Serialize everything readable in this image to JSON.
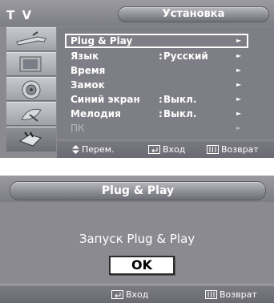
{
  "menu": {
    "tv_label": "T V",
    "title": "Установка",
    "items": [
      {
        "label": "Plug & Play",
        "value": "",
        "selected": true,
        "enabled": true
      },
      {
        "label": "Язык",
        "value": "Русский",
        "selected": false,
        "enabled": true
      },
      {
        "label": "Время",
        "value": "",
        "selected": false,
        "enabled": true
      },
      {
        "label": "Замок",
        "value": "",
        "selected": false,
        "enabled": true
      },
      {
        "label": "Синий экран",
        "value": "Выкл.",
        "selected": false,
        "enabled": true
      },
      {
        "label": "Мелодия",
        "value": "Выкл.",
        "selected": false,
        "enabled": true
      },
      {
        "label": "ПК",
        "value": "",
        "selected": false,
        "enabled": false
      }
    ],
    "arrow": "►",
    "colon": ":",
    "footer": {
      "move": "Перем.",
      "enter": "Вход",
      "return": "Возврат"
    }
  },
  "plug_dialog": {
    "title": "Plug & Play",
    "message": "Запуск Plug & Play",
    "ok_label": "OK",
    "footer": {
      "enter": "Вход",
      "return": "Возврат"
    }
  },
  "icons": [
    "antenna-icon",
    "picture-icon",
    "speaker-icon",
    "satellite-icon",
    "setup-plug-icon"
  ],
  "colors": {
    "panel": "#8a8a90",
    "content": "#7e7e86",
    "text": "#ffffff",
    "disabled": "#b8b8be"
  }
}
